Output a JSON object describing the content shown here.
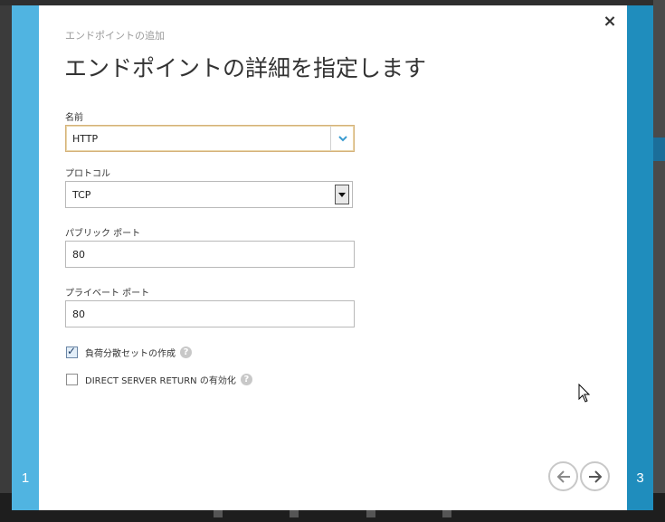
{
  "dialog": {
    "subtitle": "エンドポイントの追加",
    "title": "エンドポイントの詳細を指定します",
    "close_icon": "×",
    "step_left": "1",
    "step_right": "3"
  },
  "form": {
    "name_label": "名前",
    "name_value": "HTTP",
    "protocol_label": "プロトコル",
    "protocol_value": "TCP",
    "public_port_label": "パブリック ポート",
    "public_port_value": "80",
    "private_port_label": "プライベート ポート",
    "private_port_value": "80",
    "load_balance_label": "負荷分散セットの作成",
    "load_balance_checked": true,
    "dsr_label": "DIRECT SERVER RETURN の有効化",
    "dsr_checked": false,
    "help_glyph": "?"
  },
  "icons": {
    "close": "close-icon",
    "dropdown": "chevron-down-icon",
    "select": "triangle-down-icon",
    "back": "arrow-left-icon",
    "next": "arrow-right-icon",
    "help": "question-icon"
  },
  "colors": {
    "step_left": "#50b4e1",
    "step_right": "#1f8dbd",
    "combo_border": "#d5b27a"
  }
}
